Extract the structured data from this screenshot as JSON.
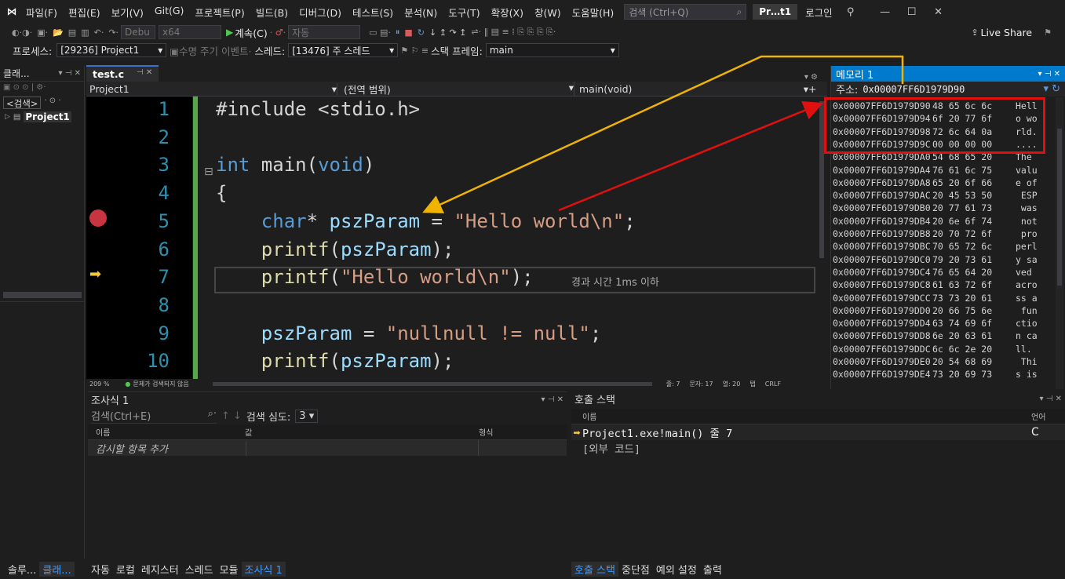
{
  "menu": {
    "items": [
      "파일(F)",
      "편집(E)",
      "보기(V)",
      "Git(G)",
      "프로젝트(P)",
      "빌드(B)",
      "디버그(D)",
      "테스트(S)",
      "분석(N)",
      "도구(T)",
      "확장(X)",
      "창(W)",
      "도움말(H)"
    ],
    "search_placeholder": "검색 (Ctrl+Q)",
    "project_badge": "Pr…t1",
    "login": "로그인"
  },
  "toolbar1": {
    "config": "Debu",
    "platform": "x64",
    "continue_label": "계속(C)",
    "auto_label": "자동",
    "live_share": "Live Share"
  },
  "toolbar2": {
    "process_label": "프로세스:",
    "process_value": "[29236] Project1",
    "lifecycle_label": "수명 주기 이벤트",
    "thread_label": "스레드:",
    "thread_value": "[13476] 주 스레드",
    "stackframe_label": "스택 프레임:",
    "stackframe_value": "main"
  },
  "left_panel": {
    "title": "클래...",
    "search": "<검색>",
    "tree_item": "Project1"
  },
  "editor": {
    "tab_name": "test.c",
    "nav_project": "Project1",
    "nav_scope": "(전역 범위)",
    "nav_function": "main(void)",
    "hint": "경과 시간 1ms 이하",
    "zoom": "209 %",
    "no_issues": "문제가 검색되지 않음",
    "status_line": "줄: 7",
    "status_char": "문자: 17",
    "status_col": "열: 20",
    "status_tab": "탭",
    "status_eol": "CRLF"
  },
  "code_lines": [
    {
      "n": "1",
      "tokens": [
        {
          "t": "#include <stdio.h>",
          "c": "pl"
        }
      ]
    },
    {
      "n": "2",
      "tokens": []
    },
    {
      "n": "3",
      "tokens": [
        {
          "t": "int",
          "c": "kw"
        },
        {
          "t": " main(",
          "c": "pl"
        },
        {
          "t": "void",
          "c": "kw"
        },
        {
          "t": ")",
          "c": "pl"
        }
      ]
    },
    {
      "n": "4",
      "tokens": [
        {
          "t": "{",
          "c": "pl"
        }
      ]
    },
    {
      "n": "5",
      "tokens": [
        {
          "t": "    ",
          "c": "pl"
        },
        {
          "t": "char",
          "c": "kw"
        },
        {
          "t": "* ",
          "c": "pl"
        },
        {
          "t": "pszParam",
          "c": "id"
        },
        {
          "t": " = ",
          "c": "pl"
        },
        {
          "t": "\"Hello world\\n\"",
          "c": "str"
        },
        {
          "t": ";",
          "c": "pl"
        }
      ]
    },
    {
      "n": "6",
      "tokens": [
        {
          "t": "    ",
          "c": "pl"
        },
        {
          "t": "printf",
          "c": "fn"
        },
        {
          "t": "(",
          "c": "pl"
        },
        {
          "t": "pszParam",
          "c": "id"
        },
        {
          "t": ");",
          "c": "pl"
        }
      ]
    },
    {
      "n": "7",
      "tokens": [
        {
          "t": "    ",
          "c": "pl"
        },
        {
          "t": "printf",
          "c": "fn"
        },
        {
          "t": "(",
          "c": "pl"
        },
        {
          "t": "\"Hello world\\n\"",
          "c": "str"
        },
        {
          "t": ");",
          "c": "pl"
        }
      ]
    },
    {
      "n": "8",
      "tokens": []
    },
    {
      "n": "9",
      "tokens": [
        {
          "t": "    ",
          "c": "pl"
        },
        {
          "t": "pszParam",
          "c": "id"
        },
        {
          "t": " = ",
          "c": "pl"
        },
        {
          "t": "\"nullnull != null\"",
          "c": "str"
        },
        {
          "t": ";",
          "c": "pl"
        }
      ]
    },
    {
      "n": "10",
      "tokens": [
        {
          "t": "    ",
          "c": "pl"
        },
        {
          "t": "printf",
          "c": "fn"
        },
        {
          "t": "(",
          "c": "pl"
        },
        {
          "t": "pszParam",
          "c": "id"
        },
        {
          "t": ");",
          "c": "pl"
        }
      ]
    }
  ],
  "memory": {
    "title": "메모리 1",
    "address_label": "주소:",
    "address_value": "0x00007FF6D1979D90",
    "rows": [
      {
        "a": "0x00007FF6D1979D90",
        "b": "48 65 6c 6c",
        "c": "Hell"
      },
      {
        "a": "0x00007FF6D1979D94",
        "b": "6f 20 77 6f",
        "c": "o wo"
      },
      {
        "a": "0x00007FF6D1979D98",
        "b": "72 6c 64 0a",
        "c": "rld."
      },
      {
        "a": "0x00007FF6D1979D9C",
        "b": "00 00 00 00",
        "c": "...."
      },
      {
        "a": "0x00007FF6D1979DA0",
        "b": "54 68 65 20",
        "c": "The "
      },
      {
        "a": "0x00007FF6D1979DA4",
        "b": "76 61 6c 75",
        "c": "valu"
      },
      {
        "a": "0x00007FF6D1979DA8",
        "b": "65 20 6f 66",
        "c": "e of"
      },
      {
        "a": "0x00007FF6D1979DAC",
        "b": "20 45 53 50",
        "c": " ESP"
      },
      {
        "a": "0x00007FF6D1979DB0",
        "b": "20 77 61 73",
        "c": " was"
      },
      {
        "a": "0x00007FF6D1979DB4",
        "b": "20 6e 6f 74",
        "c": " not"
      },
      {
        "a": "0x00007FF6D1979DB8",
        "b": "20 70 72 6f",
        "c": " pro"
      },
      {
        "a": "0x00007FF6D1979DBC",
        "b": "70 65 72 6c",
        "c": "perl"
      },
      {
        "a": "0x00007FF6D1979DC0",
        "b": "79 20 73 61",
        "c": "y sa"
      },
      {
        "a": "0x00007FF6D1979DC4",
        "b": "76 65 64 20",
        "c": "ved "
      },
      {
        "a": "0x00007FF6D1979DC8",
        "b": "61 63 72 6f",
        "c": "acro"
      },
      {
        "a": "0x00007FF6D1979DCC",
        "b": "73 73 20 61",
        "c": "ss a"
      },
      {
        "a": "0x00007FF6D1979DD0",
        "b": "20 66 75 6e",
        "c": " fun"
      },
      {
        "a": "0x00007FF6D1979DD4",
        "b": "63 74 69 6f",
        "c": "ctio"
      },
      {
        "a": "0x00007FF6D1979DD8",
        "b": "6e 20 63 61",
        "c": "n ca"
      },
      {
        "a": "0x00007FF6D1979DDC",
        "b": "6c 6c 2e 20",
        "c": "ll. "
      },
      {
        "a": "0x00007FF6D1979DE0",
        "b": "20 54 68 69",
        "c": " Thi"
      },
      {
        "a": "0x00007FF6D1979DE4",
        "b": "73 20 69 73",
        "c": "s is"
      }
    ]
  },
  "watch": {
    "title": "조사식 1",
    "search_placeholder": "검색(Ctrl+E)",
    "depth_label": "검색 심도:",
    "depth_value": "3",
    "col_name": "이름",
    "col_value": "값",
    "col_type": "형식",
    "add_item": "감시할 항목 추가"
  },
  "callstack": {
    "title": "호출 스택",
    "col_name": "이름",
    "col_lang": "언어",
    "frame1": "Project1.exe!main() 줄 7",
    "frame1_lang": "C",
    "frame2": "[외부 코드]"
  },
  "bottom_tabs_left": [
    "솔루...",
    "클래..."
  ],
  "bottom_tabs_mid": [
    "자동",
    "로컬",
    "레지스터",
    "스레드",
    "모듈",
    "조사식 1"
  ],
  "bottom_tabs_right": [
    "호출 스택",
    "중단점",
    "예외 설정",
    "출력"
  ],
  "colors": {
    "accent": "#007acc",
    "highlight_box": "#e01010",
    "arrow_yellow": "#f0b400",
    "arrow_red": "#e01010",
    "breakpoint": "#e51400",
    "current_line_arrow": "#f5c842"
  }
}
